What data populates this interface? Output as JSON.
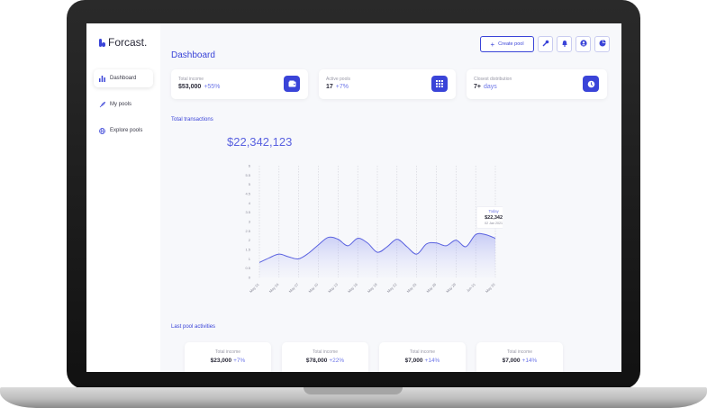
{
  "app": {
    "name": "Forcast."
  },
  "sidebar": {
    "items": [
      {
        "label": "Dashboard",
        "icon": "bar-chart-icon"
      },
      {
        "label": "My pools",
        "icon": "rocket-icon"
      },
      {
        "label": "Explore pools",
        "icon": "globe-icon"
      }
    ]
  },
  "header": {
    "title": "Dashboard",
    "create_label": "Create pool",
    "create_icon": "+"
  },
  "toolbar": {
    "icons": [
      "wrench-icon",
      "bell-icon",
      "user-icon",
      "pie-chart-icon"
    ]
  },
  "stats": [
    {
      "label": "Total income",
      "value": "$53,000",
      "change": "+55%",
      "icon": "wallet-icon"
    },
    {
      "label": "Active pools",
      "value": "17",
      "change": "+7%",
      "icon": "grid-icon"
    },
    {
      "label": "Closest distribution",
      "value": "7+",
      "change": "days",
      "icon": "timer-icon"
    }
  ],
  "transactions": {
    "title": "Total transactions",
    "total": "$22,342,123"
  },
  "chart_data": {
    "type": "area",
    "title": "",
    "xlabel": "",
    "ylabel": "",
    "y_ticks": [
      "0",
      "0.5",
      "1",
      "1.5",
      "2",
      "2.5",
      "3",
      "3.5",
      "4",
      "4.5",
      "5",
      "5.5",
      "6"
    ],
    "ylim": [
      0,
      6
    ],
    "categories": [
      "May 01",
      "May 04",
      "May 07",
      "May 10",
      "May 13",
      "May 16",
      "May 19",
      "May 22",
      "May 25",
      "May 26",
      "May 29",
      "Jun 01",
      "May 20"
    ],
    "x": [
      0,
      0.5,
      1,
      1.5,
      2,
      2.5,
      3,
      3.5,
      4,
      4.5,
      5,
      5.5,
      6,
      6.5,
      7,
      7.5,
      8,
      8.5,
      9,
      9.5,
      10,
      10.5,
      11,
      11.5,
      12
    ],
    "values": [
      0.8,
      1.05,
      1.25,
      1.1,
      1.0,
      1.3,
      1.75,
      2.15,
      2.05,
      1.7,
      2.1,
      1.85,
      1.35,
      1.65,
      2.05,
      1.65,
      1.25,
      1.8,
      1.85,
      1.7,
      2.0,
      1.65,
      2.3,
      2.3,
      2.1
    ],
    "grid": true,
    "tooltip": {
      "label": "Today",
      "value": "$22,342",
      "date": "02 Jan 2021"
    }
  },
  "activities": {
    "title": "Last pool activities",
    "cards": [
      {
        "label": "Total income",
        "value": "$23,000",
        "change": "+7%"
      },
      {
        "label": "Total income",
        "value": "$78,000",
        "change": "+22%"
      },
      {
        "label": "Total income",
        "value": "$7,000",
        "change": "+14%"
      },
      {
        "label": "Total income",
        "value": "$7,000",
        "change": "+14%"
      }
    ]
  },
  "colors": {
    "accent": "#3a44d8",
    "accent_light": "#6d76e8",
    "background": "#f7f8fb"
  }
}
